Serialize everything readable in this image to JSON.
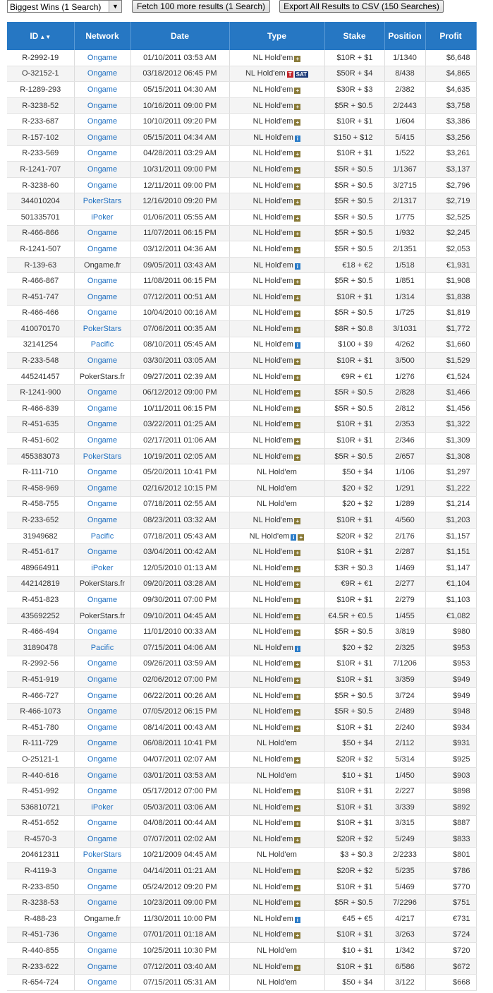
{
  "toolbar": {
    "select_value": "Biggest Wins (1 Search)",
    "fetch_label": "Fetch 100 more results (1 Search)",
    "export_label": "Export All Results to CSV (150 Searches)"
  },
  "columns": [
    "ID",
    "Network",
    "Date",
    "Type",
    "Stake",
    "Position",
    "Profit"
  ],
  "icons": {
    "plus": "plus-badge-icon",
    "info": "info-badge-icon",
    "sat": "tsat-badge-icon",
    "sort": "sort-arrow-icon"
  },
  "colors": {
    "header": "#2677c3",
    "link": "#1f6fc0",
    "plus_badge": "#8a7b3a",
    "info_badge": "#2b7cc8"
  },
  "rows": [
    {
      "id": "R-2992-19",
      "network": "Ongame",
      "date": "01/10/2011 03:53 AM",
      "type": "NL Hold'em",
      "badge": "plus",
      "stake": "$10R + $1",
      "position": "1/1340",
      "profit": "$6,648"
    },
    {
      "id": "O-32152-1",
      "network": "Ongame",
      "date": "03/18/2012 06:45 PM",
      "type": "NL Hold'em",
      "badge": "tsat",
      "badge_text": "T SAT",
      "stake": "$50R + $4",
      "position": "8/438",
      "profit": "$4,865"
    },
    {
      "id": "R-1289-293",
      "network": "Ongame",
      "date": "05/15/2011 04:30 AM",
      "type": "NL Hold'em",
      "badge": "plus",
      "stake": "$30R + $3",
      "position": "2/382",
      "profit": "$4,635"
    },
    {
      "id": "R-3238-52",
      "network": "Ongame",
      "date": "10/16/2011 09:00 PM",
      "type": "NL Hold'em",
      "badge": "plus",
      "stake": "$5R + $0.5",
      "position": "2/2443",
      "profit": "$3,758"
    },
    {
      "id": "R-233-687",
      "network": "Ongame",
      "date": "10/10/2011 09:20 PM",
      "type": "NL Hold'em",
      "badge": "plus",
      "stake": "$10R + $1",
      "position": "1/604",
      "profit": "$3,386"
    },
    {
      "id": "R-157-102",
      "network": "Ongame",
      "date": "05/15/2011 04:34 AM",
      "type": "NL Hold'em",
      "badge": "info",
      "stake": "$150 + $12",
      "position": "5/415",
      "profit": "$3,256"
    },
    {
      "id": "R-233-569",
      "network": "Ongame",
      "date": "04/28/2011 03:29 AM",
      "type": "NL Hold'em",
      "badge": "plus",
      "stake": "$10R + $1",
      "position": "1/522",
      "profit": "$3,261"
    },
    {
      "id": "R-1241-707",
      "network": "Ongame",
      "date": "10/31/2011 09:00 PM",
      "type": "NL Hold'em",
      "badge": "plus",
      "stake": "$5R + $0.5",
      "position": "1/1367",
      "profit": "$3,137"
    },
    {
      "id": "R-3238-60",
      "network": "Ongame",
      "date": "12/11/2011 09:00 PM",
      "type": "NL Hold'em",
      "badge": "plus",
      "stake": "$5R + $0.5",
      "position": "3/2715",
      "profit": "$2,796"
    },
    {
      "id": "344010204",
      "network": "PokerStars",
      "date": "12/16/2010 09:20 PM",
      "type": "NL Hold'em",
      "badge": "plus",
      "stake": "$5R + $0.5",
      "position": "2/1317",
      "profit": "$2,719"
    },
    {
      "id": "501335701",
      "network": "iPoker",
      "date": "01/06/2011 05:55 AM",
      "type": "NL Hold'em",
      "badge": "plus",
      "stake": "$5R + $0.5",
      "position": "1/775",
      "profit": "$2,525"
    },
    {
      "id": "R-466-866",
      "network": "Ongame",
      "date": "11/07/2011 06:15 PM",
      "type": "NL Hold'em",
      "badge": "plus",
      "stake": "$5R + $0.5",
      "position": "1/932",
      "profit": "$2,245"
    },
    {
      "id": "R-1241-507",
      "network": "Ongame",
      "date": "03/12/2011 04:36 AM",
      "type": "NL Hold'em",
      "badge": "plus",
      "stake": "$5R + $0.5",
      "position": "2/1351",
      "profit": "$2,053"
    },
    {
      "id": "R-139-63",
      "network": "Ongame.fr",
      "plain": true,
      "date": "09/05/2011 03:43 AM",
      "type": "NL Hold'em",
      "badge": "info",
      "stake": "€18 + €2",
      "position": "1/518",
      "profit": "€1,931"
    },
    {
      "id": "R-466-867",
      "network": "Ongame",
      "date": "11/08/2011 06:15 PM",
      "type": "NL Hold'em",
      "badge": "plus",
      "stake": "$5R + $0.5",
      "position": "1/851",
      "profit": "$1,908"
    },
    {
      "id": "R-451-747",
      "network": "Ongame",
      "date": "07/12/2011 00:51 AM",
      "type": "NL Hold'em",
      "badge": "plus",
      "stake": "$10R + $1",
      "position": "1/314",
      "profit": "$1,838"
    },
    {
      "id": "R-466-466",
      "network": "Ongame",
      "date": "10/04/2010 00:16 AM",
      "type": "NL Hold'em",
      "badge": "plus",
      "stake": "$5R + $0.5",
      "position": "1/725",
      "profit": "$1,819"
    },
    {
      "id": "410070170",
      "network": "PokerStars",
      "date": "07/06/2011 00:35 AM",
      "type": "NL Hold'em",
      "badge": "plus",
      "stake": "$8R + $0.8",
      "position": "3/1031",
      "profit": "$1,772"
    },
    {
      "id": "32141254",
      "network": "Pacific",
      "date": "08/10/2011 05:45 AM",
      "type": "NL Hold'em",
      "badge": "info",
      "stake": "$100 + $9",
      "position": "4/262",
      "profit": "$1,660"
    },
    {
      "id": "R-233-548",
      "network": "Ongame",
      "date": "03/30/2011 03:05 AM",
      "type": "NL Hold'em",
      "badge": "plus",
      "stake": "$10R + $1",
      "position": "3/500",
      "profit": "$1,529"
    },
    {
      "id": "445241457",
      "network": "PokerStars.fr",
      "plain": true,
      "date": "09/27/2011 02:39 AM",
      "type": "NL Hold'em",
      "badge": "plus",
      "stake": "€9R + €1",
      "position": "1/276",
      "profit": "€1,524"
    },
    {
      "id": "R-1241-900",
      "network": "Ongame",
      "date": "06/12/2012 09:00 PM",
      "type": "NL Hold'em",
      "badge": "plus",
      "stake": "$5R + $0.5",
      "position": "2/828",
      "profit": "$1,466"
    },
    {
      "id": "R-466-839",
      "network": "Ongame",
      "date": "10/11/2011 06:15 PM",
      "type": "NL Hold'em",
      "badge": "plus",
      "stake": "$5R + $0.5",
      "position": "2/812",
      "profit": "$1,456"
    },
    {
      "id": "R-451-635",
      "network": "Ongame",
      "date": "03/22/2011 01:25 AM",
      "type": "NL Hold'em",
      "badge": "plus",
      "stake": "$10R + $1",
      "position": "2/353",
      "profit": "$1,322"
    },
    {
      "id": "R-451-602",
      "network": "Ongame",
      "date": "02/17/2011 01:06 AM",
      "type": "NL Hold'em",
      "badge": "plus",
      "stake": "$10R + $1",
      "position": "2/346",
      "profit": "$1,309"
    },
    {
      "id": "455383073",
      "network": "PokerStars",
      "date": "10/19/2011 02:05 AM",
      "type": "NL Hold'em",
      "badge": "plus",
      "stake": "$5R + $0.5",
      "position": "2/657",
      "profit": "$1,308"
    },
    {
      "id": "R-111-710",
      "network": "Ongame",
      "date": "05/20/2011 10:41 PM",
      "type": "NL Hold'em",
      "badge": "",
      "stake": "$50 + $4",
      "position": "1/106",
      "profit": "$1,297"
    },
    {
      "id": "R-458-969",
      "network": "Ongame",
      "date": "02/16/2012 10:15 PM",
      "type": "NL Hold'em",
      "badge": "",
      "stake": "$20 + $2",
      "position": "1/291",
      "profit": "$1,222"
    },
    {
      "id": "R-458-755",
      "network": "Ongame",
      "date": "07/18/2011 02:55 AM",
      "type": "NL Hold'em",
      "badge": "",
      "stake": "$20 + $2",
      "position": "1/289",
      "profit": "$1,214"
    },
    {
      "id": "R-233-652",
      "network": "Ongame",
      "date": "08/23/2011 03:32 AM",
      "type": "NL Hold'em",
      "badge": "plus",
      "stake": "$10R + $1",
      "position": "4/560",
      "profit": "$1,203"
    },
    {
      "id": "31949682",
      "network": "Pacific",
      "date": "07/18/2011 05:43 AM",
      "type": "NL Hold'em",
      "badge": "info",
      "badge2": "plus",
      "stake": "$20R + $2",
      "position": "2/176",
      "profit": "$1,157"
    },
    {
      "id": "R-451-617",
      "network": "Ongame",
      "date": "03/04/2011 00:42 AM",
      "type": "NL Hold'em",
      "badge": "plus",
      "stake": "$10R + $1",
      "position": "2/287",
      "profit": "$1,151"
    },
    {
      "id": "489664911",
      "network": "iPoker",
      "date": "12/05/2010 01:13 AM",
      "type": "NL Hold'em",
      "badge": "plus",
      "stake": "$3R + $0.3",
      "position": "1/469",
      "profit": "$1,147"
    },
    {
      "id": "442142819",
      "network": "PokerStars.fr",
      "plain": true,
      "date": "09/20/2011 03:28 AM",
      "type": "NL Hold'em",
      "badge": "plus",
      "stake": "€9R + €1",
      "position": "2/277",
      "profit": "€1,104"
    },
    {
      "id": "R-451-823",
      "network": "Ongame",
      "date": "09/30/2011 07:00 PM",
      "type": "NL Hold'em",
      "badge": "plus",
      "stake": "$10R + $1",
      "position": "2/279",
      "profit": "$1,103"
    },
    {
      "id": "435692252",
      "network": "PokerStars.fr",
      "plain": true,
      "date": "09/10/2011 04:45 AM",
      "type": "NL Hold'em",
      "badge": "plus",
      "stake": "€4.5R + €0.5",
      "position": "1/455",
      "profit": "€1,082"
    },
    {
      "id": "R-466-494",
      "network": "Ongame",
      "date": "11/01/2010 00:33 AM",
      "type": "NL Hold'em",
      "badge": "plus",
      "stake": "$5R + $0.5",
      "position": "3/819",
      "profit": "$980"
    },
    {
      "id": "31890478",
      "network": "Pacific",
      "date": "07/15/2011 04:06 AM",
      "type": "NL Hold'em",
      "badge": "info",
      "stake": "$20 + $2",
      "position": "2/325",
      "profit": "$953"
    },
    {
      "id": "R-2992-56",
      "network": "Ongame",
      "date": "09/26/2011 03:59 AM",
      "type": "NL Hold'em",
      "badge": "plus",
      "stake": "$10R + $1",
      "position": "7/1206",
      "profit": "$953"
    },
    {
      "id": "R-451-919",
      "network": "Ongame",
      "date": "02/06/2012 07:00 PM",
      "type": "NL Hold'em",
      "badge": "plus",
      "stake": "$10R + $1",
      "position": "3/359",
      "profit": "$949"
    },
    {
      "id": "R-466-727",
      "network": "Ongame",
      "date": "06/22/2011 00:26 AM",
      "type": "NL Hold'em",
      "badge": "plus",
      "stake": "$5R + $0.5",
      "position": "3/724",
      "profit": "$949"
    },
    {
      "id": "R-466-1073",
      "network": "Ongame",
      "date": "07/05/2012 06:15 PM",
      "type": "NL Hold'em",
      "badge": "plus",
      "stake": "$5R + $0.5",
      "position": "2/489",
      "profit": "$948"
    },
    {
      "id": "R-451-780",
      "network": "Ongame",
      "date": "08/14/2011 00:43 AM",
      "type": "NL Hold'em",
      "badge": "plus",
      "stake": "$10R + $1",
      "position": "2/240",
      "profit": "$934"
    },
    {
      "id": "R-111-729",
      "network": "Ongame",
      "date": "06/08/2011 10:41 PM",
      "type": "NL Hold'em",
      "badge": "",
      "stake": "$50 + $4",
      "position": "2/112",
      "profit": "$931"
    },
    {
      "id": "O-25121-1",
      "network": "Ongame",
      "date": "04/07/2011 02:07 AM",
      "type": "NL Hold'em",
      "badge": "plus",
      "stake": "$20R + $2",
      "position": "5/314",
      "profit": "$925"
    },
    {
      "id": "R-440-616",
      "network": "Ongame",
      "date": "03/01/2011 03:53 AM",
      "type": "NL Hold'em",
      "badge": "",
      "stake": "$10 + $1",
      "position": "1/450",
      "profit": "$903"
    },
    {
      "id": "R-451-992",
      "network": "Ongame",
      "date": "05/17/2012 07:00 PM",
      "type": "NL Hold'em",
      "badge": "plus",
      "stake": "$10R + $1",
      "position": "2/227",
      "profit": "$898"
    },
    {
      "id": "536810721",
      "network": "iPoker",
      "date": "05/03/2011 03:06 AM",
      "type": "NL Hold'em",
      "badge": "plus",
      "stake": "$10R + $1",
      "position": "3/339",
      "profit": "$892"
    },
    {
      "id": "R-451-652",
      "network": "Ongame",
      "date": "04/08/2011 00:44 AM",
      "type": "NL Hold'em",
      "badge": "plus",
      "stake": "$10R + $1",
      "position": "3/315",
      "profit": "$887"
    },
    {
      "id": "R-4570-3",
      "network": "Ongame",
      "date": "07/07/2011 02:02 AM",
      "type": "NL Hold'em",
      "badge": "plus",
      "stake": "$20R + $2",
      "position": "5/249",
      "profit": "$833"
    },
    {
      "id": "204612311",
      "network": "PokerStars",
      "date": "10/21/2009 04:45 AM",
      "type": "NL Hold'em",
      "badge": "",
      "stake": "$3 + $0.3",
      "position": "2/2233",
      "profit": "$801"
    },
    {
      "id": "R-4119-3",
      "network": "Ongame",
      "date": "04/14/2011 01:21 AM",
      "type": "NL Hold'em",
      "badge": "plus",
      "stake": "$20R + $2",
      "position": "5/235",
      "profit": "$786"
    },
    {
      "id": "R-233-850",
      "network": "Ongame",
      "date": "05/24/2012 09:20 PM",
      "type": "NL Hold'em",
      "badge": "plus",
      "stake": "$10R + $1",
      "position": "5/469",
      "profit": "$770"
    },
    {
      "id": "R-3238-53",
      "network": "Ongame",
      "date": "10/23/2011 09:00 PM",
      "type": "NL Hold'em",
      "badge": "plus",
      "stake": "$5R + $0.5",
      "position": "7/2296",
      "profit": "$751"
    },
    {
      "id": "R-488-23",
      "network": "Ongame.fr",
      "plain": true,
      "date": "11/30/2011 10:00 PM",
      "type": "NL Hold'em",
      "badge": "info",
      "stake": "€45 + €5",
      "position": "4/217",
      "profit": "€731"
    },
    {
      "id": "R-451-736",
      "network": "Ongame",
      "date": "07/01/2011 01:18 AM",
      "type": "NL Hold'em",
      "badge": "plus",
      "stake": "$10R + $1",
      "position": "3/263",
      "profit": "$724"
    },
    {
      "id": "R-440-855",
      "network": "Ongame",
      "date": "10/25/2011 10:30 PM",
      "type": "NL Hold'em",
      "badge": "",
      "stake": "$10 + $1",
      "position": "1/342",
      "profit": "$720"
    },
    {
      "id": "R-233-622",
      "network": "Ongame",
      "date": "07/12/2011 03:40 AM",
      "type": "NL Hold'em",
      "badge": "plus",
      "stake": "$10R + $1",
      "position": "6/586",
      "profit": "$672"
    },
    {
      "id": "R-654-724",
      "network": "Ongame",
      "date": "07/15/2011 05:31 AM",
      "type": "NL Hold'em",
      "badge": "",
      "stake": "$50 + $4",
      "position": "3/122",
      "profit": "$668"
    }
  ]
}
